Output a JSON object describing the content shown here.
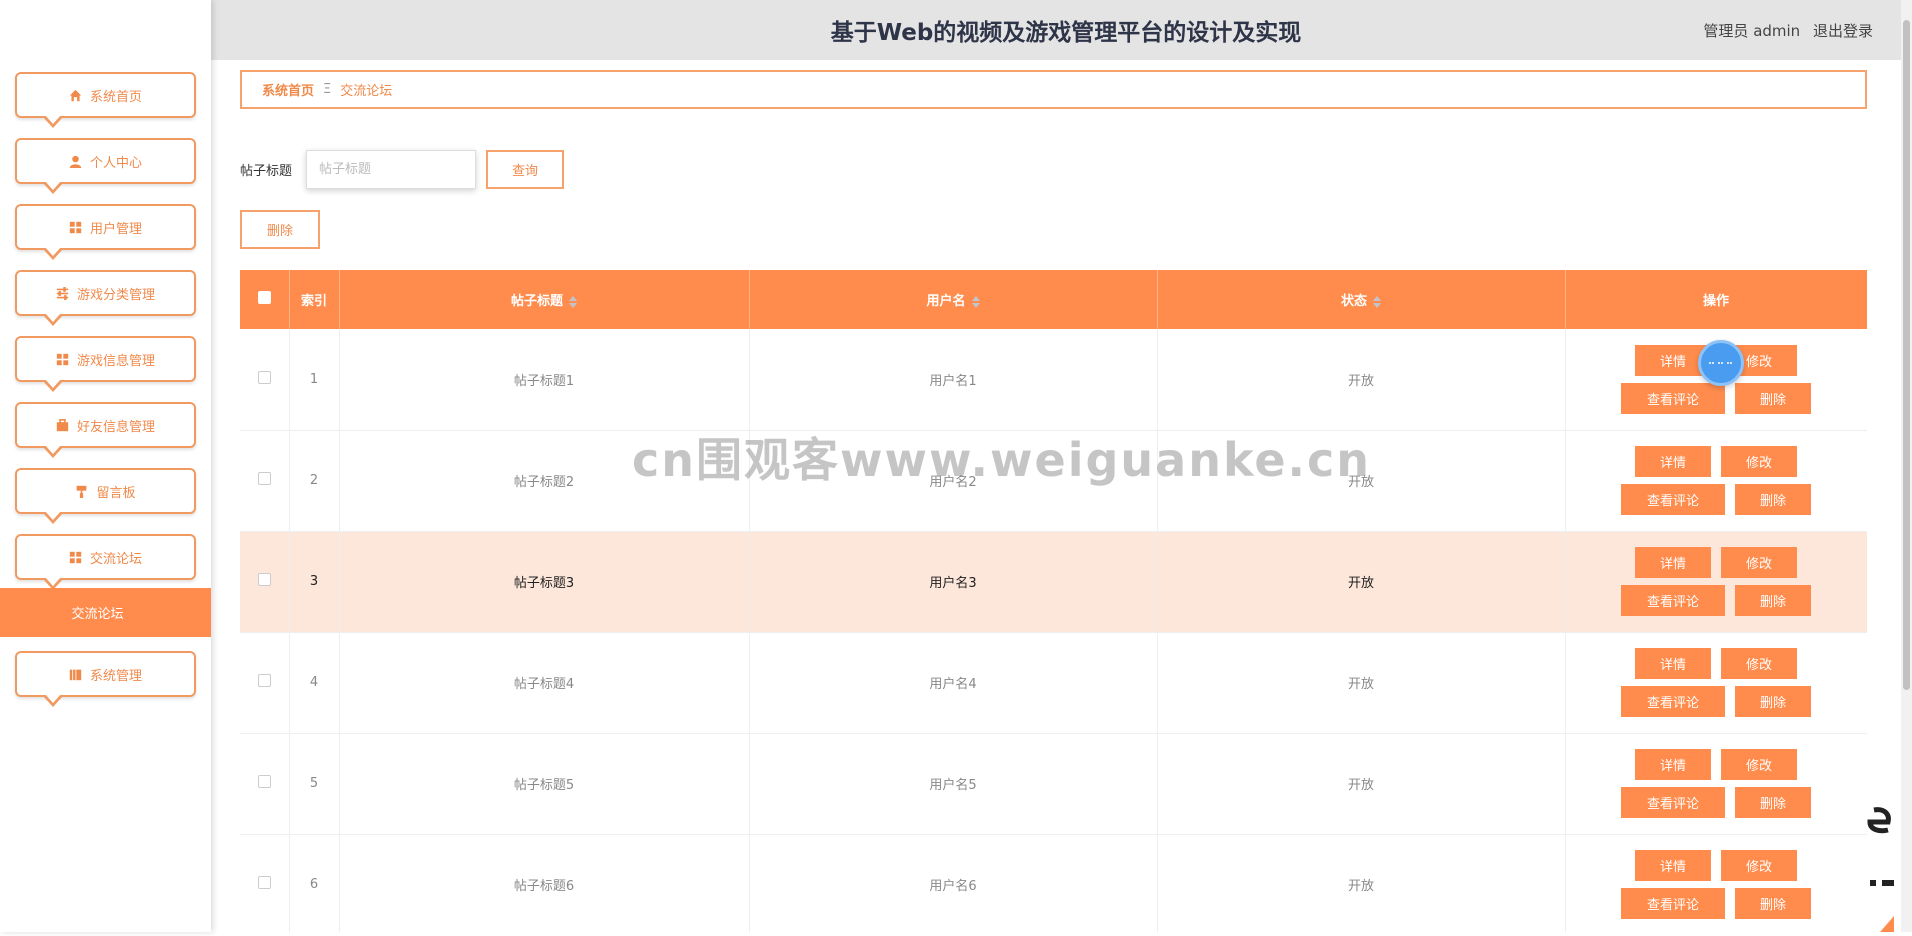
{
  "header": {
    "title": "基于Web的视频及游戏管理平台的设计及实现",
    "user_role": "管理员 admin",
    "logout": "退出登录"
  },
  "sidebar": {
    "items": [
      {
        "label": "系统首页",
        "icon": "home-icon"
      },
      {
        "label": "个人中心",
        "icon": "user-icon"
      },
      {
        "label": "用户管理",
        "icon": "grid-icon"
      },
      {
        "label": "游戏分类管理",
        "icon": "sliders-icon"
      },
      {
        "label": "游戏信息管理",
        "icon": "grid-icon"
      },
      {
        "label": "好友信息管理",
        "icon": "briefcase-icon"
      },
      {
        "label": "留言板",
        "icon": "paint-roller-icon"
      },
      {
        "label": "交流论坛",
        "icon": "grid-icon"
      },
      {
        "label": "系统管理",
        "icon": "book-icon"
      }
    ],
    "active_sub": "交流论坛"
  },
  "breadcrumb": {
    "home": "系统首页",
    "separator": "Ξ",
    "current": "交流论坛"
  },
  "search": {
    "label": "帖子标题",
    "placeholder": "帖子标题",
    "value": "",
    "query_button": "查询"
  },
  "toolbar": {
    "delete_button": "删除"
  },
  "table": {
    "columns": [
      "索引",
      "帖子标题",
      "用户名",
      "状态",
      "操作"
    ],
    "rows": [
      {
        "index": "1",
        "title": "帖子标题1",
        "username": "用户名1",
        "status": "开放"
      },
      {
        "index": "2",
        "title": "帖子标题2",
        "username": "用户名2",
        "status": "开放"
      },
      {
        "index": "3",
        "title": "帖子标题3",
        "username": "用户名3",
        "status": "开放",
        "highlighted": true
      },
      {
        "index": "4",
        "title": "帖子标题4",
        "username": "用户名4",
        "status": "开放"
      },
      {
        "index": "5",
        "title": "帖子标题5",
        "username": "用户名5",
        "status": "开放"
      },
      {
        "index": "6",
        "title": "帖子标题6",
        "username": "用户名6",
        "status": "开放"
      }
    ],
    "actions": {
      "detail": "详情",
      "edit": "修改",
      "comments": "查看评论",
      "delete": "删除"
    }
  },
  "watermark": "cn围观客www.weiguanke.cn",
  "colors": {
    "accent": "#ff8c4d",
    "border": "#f5a26d",
    "highlight_row": "#fde6da",
    "header_bg": "#e5e4e5"
  }
}
